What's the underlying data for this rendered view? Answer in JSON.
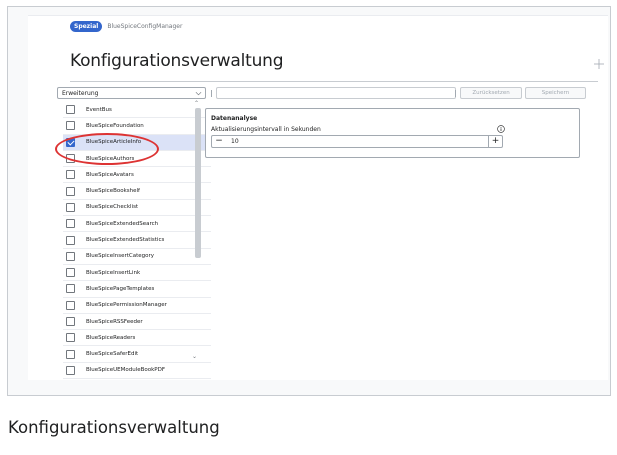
{
  "breadcrumb": {
    "badge": "Spezial",
    "page": "BlueSpiceConfigManager"
  },
  "page_title": "Konfigurationsverwaltung",
  "toolbar": {
    "filter_selected": "Erweiterung",
    "search_value": "",
    "reset_label": "Zurücksetzen",
    "save_label": "Speichern"
  },
  "extensions": [
    {
      "label": "EventBus",
      "checked": false
    },
    {
      "label": "BlueSpiceFoundation",
      "checked": false
    },
    {
      "label": "BlueSpiceArticleInfo",
      "checked": true
    },
    {
      "label": "BlueSpiceAuthors",
      "checked": false
    },
    {
      "label": "BlueSpiceAvatars",
      "checked": false
    },
    {
      "label": "BlueSpiceBookshelf",
      "checked": false
    },
    {
      "label": "BlueSpiceChecklist",
      "checked": false
    },
    {
      "label": "BlueSpiceExtendedSearch",
      "checked": false
    },
    {
      "label": "BlueSpiceExtendedStatistics",
      "checked": false
    },
    {
      "label": "BlueSpiceInsertCategory",
      "checked": false
    },
    {
      "label": "BlueSpiceInsertLink",
      "checked": false
    },
    {
      "label": "BlueSpicePageTemplates",
      "checked": false
    },
    {
      "label": "BlueSpicePermissionManager",
      "checked": false
    },
    {
      "label": "BlueSpiceRSSFeeder",
      "checked": false
    },
    {
      "label": "BlueSpiceReaders",
      "checked": false
    },
    {
      "label": "BlueSpiceSaferEdit",
      "checked": false
    },
    {
      "label": "BlueSpiceUEModuleBookPDF",
      "checked": false
    }
  ],
  "panel": {
    "title": "Datenanalyse",
    "field_label": "Aktualisierungsintervall in Sekunden",
    "value": "10",
    "minus": "−",
    "plus": "+"
  },
  "caption": "Konfigurationsverwaltung",
  "colors": {
    "accent": "#3366cc",
    "highlight": "#dd3333",
    "selected_row": "#dbe2f7"
  }
}
